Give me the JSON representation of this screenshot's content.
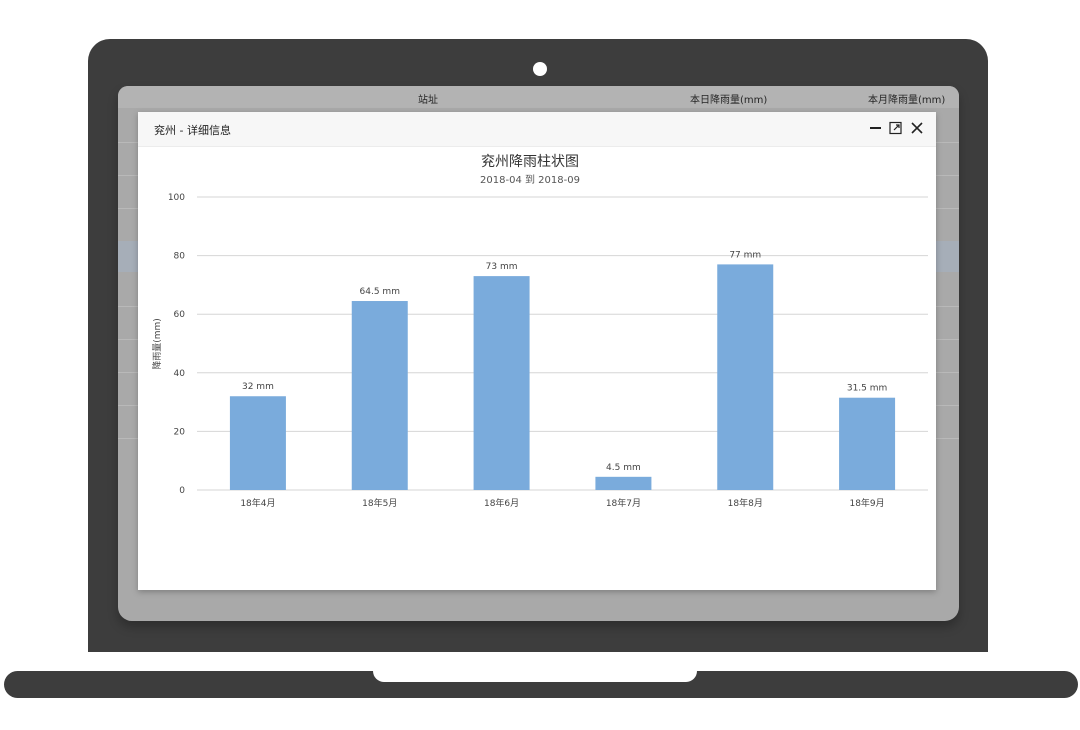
{
  "background_table": {
    "headers": [
      "站址",
      "本日降雨量(mm)",
      "本月降雨量(mm)"
    ]
  },
  "modal": {
    "title": "兖州 - 详细信息",
    "controls": [
      "minimize-icon",
      "maximize-icon",
      "close-icon"
    ]
  },
  "colors": {
    "bar": "#7aabdc",
    "gridline": "#d6d6d6",
    "laptop": "#3d3d3d"
  },
  "chart_data": {
    "type": "bar",
    "title": "兖州降雨柱状图",
    "subtitle": "2018-04 到 2018-09",
    "ylabel": "降雨量(mm)",
    "xlabel": "",
    "categories": [
      "18年4月",
      "18年5月",
      "18年6月",
      "18年7月",
      "18年8月",
      "18年9月"
    ],
    "values": [
      32,
      64.5,
      73,
      4.5,
      77,
      31.5
    ],
    "data_labels": [
      "32 mm",
      "64.5 mm",
      "73 mm",
      "4.5 mm",
      "77 mm",
      "31.5 mm"
    ],
    "ylim": [
      0,
      100
    ],
    "yticks": [
      0,
      20,
      40,
      60,
      80,
      100
    ],
    "grid": true,
    "legend": false
  }
}
